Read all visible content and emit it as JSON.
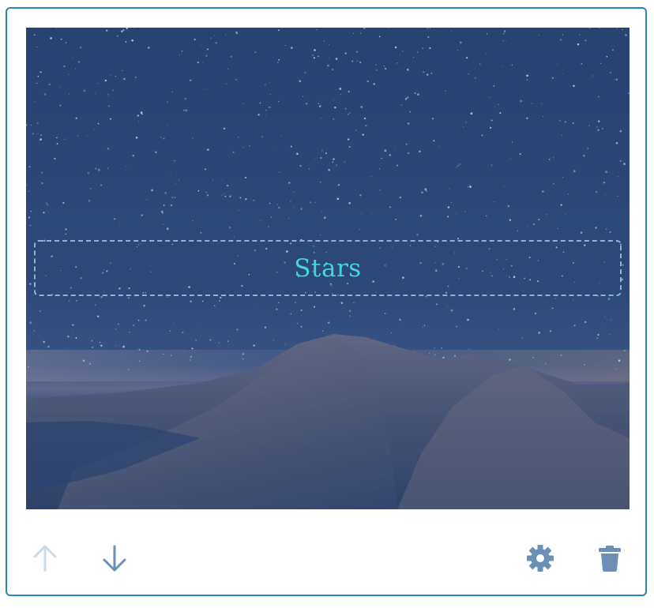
{
  "block": {
    "caption": "Stars",
    "image_description_icon": "starry-mountain-image"
  },
  "toolbar": {
    "move_up_icon": "arrow-up-icon",
    "move_up_disabled": true,
    "move_down_icon": "arrow-down-icon",
    "settings_icon": "gear-icon",
    "delete_icon": "trash-icon"
  },
  "colors": {
    "border": "#2a86b3",
    "caption": "#3fd6dc",
    "icon_active": "#6b8fb5",
    "icon_disabled": "#c9d9ea",
    "overlay": "#2a4676"
  }
}
